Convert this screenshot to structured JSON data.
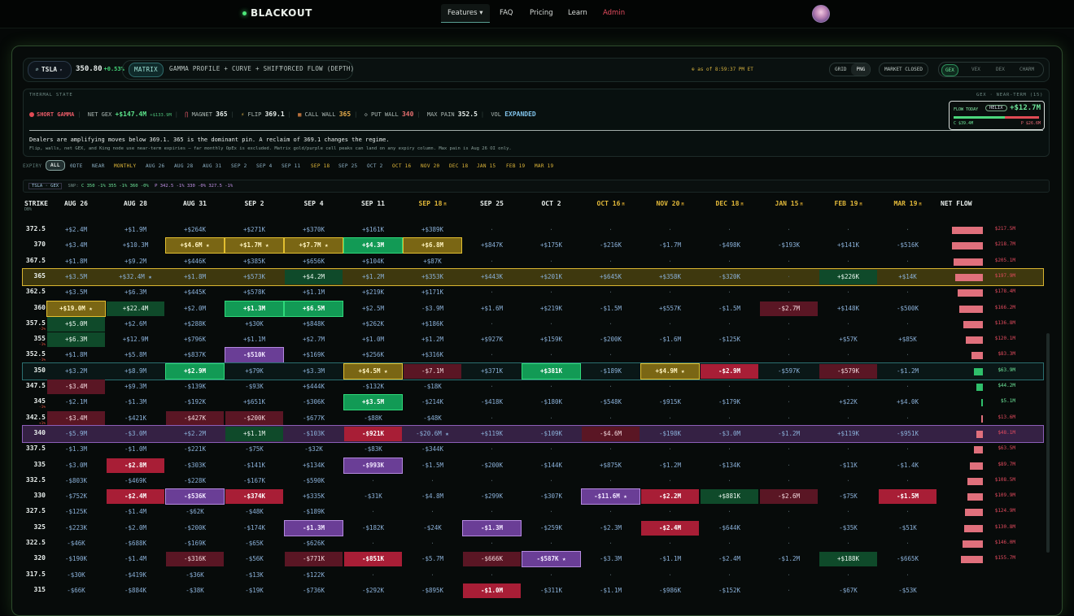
{
  "nav": {
    "brand": "BLACKOUT",
    "items": [
      {
        "label": "Features ▾",
        "active": true
      },
      {
        "label": "FAQ"
      },
      {
        "label": "Pricing"
      },
      {
        "label": "Learn"
      },
      {
        "label": "Admin",
        "admin": true
      }
    ]
  },
  "toolbar": {
    "ticker": "TSLA",
    "price": "350.80",
    "change": "+0.53%",
    "views": [
      "MATRIX",
      "GAMMA PROFILE + CURVE + SHIFT",
      "FORCED FLOW (DEPTH)"
    ],
    "as_of": "⊕ as of 8:59:37 PM ET",
    "layout_toggle": [
      "GRID",
      "PNG"
    ],
    "market_status": "MARKET CLOSED",
    "greeks": [
      "GEX",
      "VEX",
      "DEX",
      "CHARM"
    ]
  },
  "thermal": {
    "title": "THERMAL STATE",
    "right_label": "GEX · NEAR-TERM (15)",
    "gamma": "SHORT GAMMA",
    "net_gex_label": "NET GEX",
    "net_gex": "+$147.4M",
    "net_gex_sub": "+$133.9M",
    "magnet_label": "MAGNET",
    "magnet": "365",
    "flip_label": "FLIP",
    "flip": "369.1",
    "call_wall_label": "CALL WALL",
    "call_wall": "365",
    "put_wall_label": "PUT WALL",
    "put_wall": "340",
    "max_pain_label": "MAX PAIN",
    "max_pain": "352.5",
    "vol_label": "VOL",
    "vol": "EXPANDED",
    "flow_today_label": "FLOW TODAY",
    "flow_badge": "HELIX",
    "flow_today": "+$12.7M",
    "flow_call": "C $39.4M",
    "flow_put": "P $26.6M",
    "flow_call_share": 0.6,
    "message": "Dealers are amplifying moves below 369.1. 365 is the dominant pin. A reclaim of 369.1 changes the regime.",
    "note": "Flip, walls, net GEX, and King node use near-term expiries — far monthly OpEx is excluded. Matrix gold/purple cell peaks can land on any expiry column. Max pain is Aug 26 OI only."
  },
  "expiry": {
    "label": "EXPIRY",
    "items": [
      {
        "label": "ALL",
        "on": true
      },
      {
        "label": "0DTE"
      },
      {
        "label": "NEAR"
      },
      {
        "label": "MONTHLY",
        "m": true
      },
      {
        "label": "AUG 26"
      },
      {
        "label": "AUG 28"
      },
      {
        "label": "AUG 31"
      },
      {
        "label": "SEP 2"
      },
      {
        "label": "SEP 4"
      },
      {
        "label": "SEP 11"
      },
      {
        "label": "SEP 18",
        "m": true
      },
      {
        "label": "SEP 25"
      },
      {
        "label": "OCT 2"
      },
      {
        "label": "OCT 16",
        "m": true
      },
      {
        "label": "NOV 20",
        "m": true
      },
      {
        "label": "DEC 18",
        "m": true
      },
      {
        "label": "JAN 15",
        "m": true
      },
      {
        "label": "FEB 19",
        "m": true
      },
      {
        "label": "MAR 19",
        "m": true
      }
    ]
  },
  "snapshot": {
    "tag": "TSLA · GEX",
    "label": "SNP:",
    "calls": "C 350 -1% 355 -1% 360 -0%",
    "puts": "P 342.5 -1% 330 -0% 327.5 -1%"
  },
  "matrix": {
    "strike_header": "STRIKE",
    "strike_sub": "DB%",
    "net_flow_header": "NET FLOW",
    "columns": [
      {
        "label": "AUG 26"
      },
      {
        "label": "AUG 28"
      },
      {
        "label": "AUG 31"
      },
      {
        "label": "SEP 2"
      },
      {
        "label": "SEP 4"
      },
      {
        "label": "SEP 11"
      },
      {
        "label": "SEP 18",
        "m": true
      },
      {
        "label": "SEP 25"
      },
      {
        "label": "OCT 2"
      },
      {
        "label": "OCT 16",
        "m": true
      },
      {
        "label": "NOV 20",
        "m": true
      },
      {
        "label": "DEC 18",
        "m": true
      },
      {
        "label": "JAN 15",
        "m": true
      },
      {
        "label": "FEB 19",
        "m": true
      },
      {
        "label": "MAR 19",
        "m": true
      }
    ],
    "rows": [
      {
        "strike": "372.5",
        "cells": [
          "+$2.4M",
          "+$1.9M",
          "+$264K",
          "+$271K",
          "+$370K",
          "+$161K",
          "+$389K",
          "·",
          "·",
          "·",
          "·",
          "·",
          "·",
          "·",
          "·"
        ],
        "flow": "$217.5M",
        "flowv": 217.5
      },
      {
        "strike": "370",
        "cells": [
          "+$3.4M",
          "+$10.3M",
          "+$4.6M ★|y2",
          "+$1.7M ★|y2",
          "+$7.7M ★|y2",
          "+$4.3M|g2",
          "+$6.8M|y2",
          "+$847K",
          "+$175K",
          "-$216K",
          "-$1.7M",
          "-$498K",
          "-$193K",
          "+$141K",
          "-$516K"
        ],
        "flow": "$218.7M",
        "flowv": 218.7
      },
      {
        "strike": "367.5",
        "cells": [
          "+$1.8M",
          "+$9.2M",
          "+$446K",
          "+$385K",
          "+$656K",
          "+$104K",
          "+$87K",
          "·",
          "·",
          "·",
          "·",
          "·",
          "·",
          "·",
          "·"
        ],
        "flow": "$205.1M",
        "flowv": 205.1
      },
      {
        "strike": "365",
        "row": "gold",
        "cells": [
          "+$3.5M",
          "+$32.4M ★",
          "+$1.8M",
          "+$573K",
          "+$4.2M|g1",
          "+$1.2M",
          "+$353K",
          "+$443K",
          "+$201K",
          "+$645K",
          "+$358K",
          "-$320K",
          "·",
          "+$226K|g1",
          "+$14K"
        ],
        "flow": "$197.9M",
        "flowv": 197.9
      },
      {
        "strike": "362.5",
        "cells": [
          "+$3.5M",
          "+$6.3M",
          "+$445K",
          "+$578K",
          "+$1.1M",
          "+$219K",
          "+$171K",
          "·",
          "·",
          "·",
          "·",
          "·",
          "·",
          "·",
          "·"
        ],
        "flow": "$178.4M",
        "flowv": 178.4
      },
      {
        "strike": "360",
        "cells": [
          "+$19.0M ★|y2",
          "+$22.4M|g1",
          "+$2.0M",
          "+$1.3M|g2",
          "+$6.5M|g2",
          "+$2.5M",
          "-$3.9M",
          "+$1.6M",
          "+$219K",
          "-$1.5M",
          "+$557K",
          "-$1.5M",
          "-$2.7M|r1",
          "+$148K",
          "-$500K"
        ],
        "flow": "$166.2M",
        "flowv": 166.2
      },
      {
        "strike": "357.5",
        "sub": "-2%",
        "cells": [
          "+$5.0M|g1",
          "+$2.6M",
          "+$288K",
          "+$30K",
          "+$848K",
          "+$262K",
          "+$186K",
          "·",
          "·",
          "·",
          "·",
          "·",
          "·",
          "·",
          "·"
        ],
        "flow": "$136.8M",
        "flowv": 136.8
      },
      {
        "strike": "355",
        "sub": "-1%",
        "cells": [
          "+$6.3M|g1",
          "+$12.9M",
          "+$796K",
          "+$1.1M",
          "+$2.7M",
          "+$1.0M",
          "+$1.2M",
          "+$927K",
          "+$159K",
          "-$200K",
          "-$1.6M",
          "-$125K",
          "·",
          "+$57K",
          "+$85K"
        ],
        "flow": "$120.1M",
        "flowv": 120.1
      },
      {
        "strike": "352.5",
        "sub": "-1%",
        "cells": [
          "+$1.8M",
          "+$5.8M",
          "+$837K",
          "-$510K|p1",
          "+$169K",
          "+$256K",
          "+$316K",
          "·",
          "·",
          "·",
          "·",
          "·",
          "·",
          "·",
          "·"
        ],
        "flow": "$83.3M",
        "flowv": 83.3
      },
      {
        "strike": "350",
        "row": "teal",
        "cells": [
          "+$3.2M",
          "+$8.9M",
          "+$2.9M|g2",
          "+$79K",
          "+$3.3M",
          "+$4.5M ★|y2",
          "-$7.1M|r1",
          "+$371K",
          "+$381K|g2",
          "-$189K",
          "+$4.9M ★|y2",
          "-$2.9M|r2",
          "-$597K",
          "-$579K|r1",
          "-$1.2M"
        ],
        "flow": "$63.9M",
        "flowv": 63.9,
        "flowpos": true
      },
      {
        "strike": "347.5",
        "cells": [
          "-$3.4M|r1",
          "+$9.3M",
          "-$139K",
          "-$93K",
          "+$444K",
          "-$132K",
          "-$18K",
          "·",
          "·",
          "·",
          "·",
          "·",
          "·",
          "·",
          "·"
        ],
        "flow": "$44.2M",
        "flowv": 44.2,
        "flowpos": true
      },
      {
        "strike": "345",
        "sub": "-1%",
        "cells": [
          "-$2.1M",
          "-$1.3M",
          "-$192K",
          "+$651K",
          "-$306K",
          "+$3.5M|g2",
          "-$214K",
          "-$418K",
          "-$180K",
          "-$548K",
          "-$915K",
          "-$179K",
          "·",
          "+$22K",
          "+$4.0K"
        ],
        "flow": "$5.1M",
        "flowv": 5.1,
        "flowpos": true
      },
      {
        "strike": "342.5",
        "sub": "+1%",
        "cells": [
          "-$3.4M|r1",
          "-$421K",
          "-$427K|r1",
          "-$200K|r1",
          "-$677K",
          "-$88K",
          "-$48K",
          "·",
          "·",
          "·",
          "·",
          "·",
          "·",
          "·",
          "·"
        ],
        "flow": "$13.6M",
        "flowv": 13.6
      },
      {
        "strike": "340",
        "row": "purple",
        "cells": [
          "-$5.9M",
          "-$3.0M",
          "+$2.2M",
          "+$1.1M|g1",
          "-$103K",
          "-$921K|r2",
          "-$20.6M ★",
          "+$119K",
          "-$109K",
          "-$4.6M|r1",
          "-$198K",
          "-$3.0M",
          "-$1.2M",
          "+$119K",
          "-$951K"
        ],
        "flow": "$48.1M",
        "flowv": 48.1
      },
      {
        "strike": "337.5",
        "cells": [
          "-$1.3M",
          "-$1.0M",
          "-$221K",
          "-$75K",
          "-$32K",
          "-$83K",
          "-$344K",
          "·",
          "·",
          "·",
          "·",
          "·",
          "·",
          "·",
          "·"
        ],
        "flow": "$63.5M",
        "flowv": 63.5
      },
      {
        "strike": "335",
        "cells": [
          "-$3.0M",
          "-$2.8M|r2",
          "-$303K",
          "-$141K",
          "+$134K",
          "-$993K|p1",
          "-$1.5M",
          "-$200K",
          "-$144K",
          "+$875K",
          "-$1.2M",
          "-$134K",
          "·",
          "-$11K",
          "-$1.4K"
        ],
        "flow": "$89.7M",
        "flowv": 89.7
      },
      {
        "strike": "332.5",
        "cells": [
          "-$803K",
          "-$469K",
          "-$228K",
          "-$167K",
          "-$590K",
          "·",
          "·",
          "·",
          "·",
          "·",
          "·",
          "·",
          "·",
          "·",
          "·"
        ],
        "flow": "$108.5M",
        "flowv": 108.5
      },
      {
        "strike": "330",
        "cells": [
          "-$752K",
          "-$2.4M|r2",
          "-$536K|p1",
          "-$374K|r2",
          "+$335K",
          "-$31K",
          "-$4.8M",
          "-$299K",
          "-$307K",
          "-$11.6M ★|p1",
          "-$2.2M|r2",
          "+$881K|g1",
          "-$2.6M|r1",
          "-$75K",
          "-$1.5M|r2"
        ],
        "flow": "$109.9M",
        "flowv": 109.9
      },
      {
        "strike": "327.5",
        "cells": [
          "-$125K",
          "-$1.4M",
          "-$62K",
          "-$48K",
          "-$189K",
          "·",
          "·",
          "·",
          "·",
          "·",
          "·",
          "·",
          "·",
          "·",
          "·"
        ],
        "flow": "$124.9M",
        "flowv": 124.9
      },
      {
        "strike": "325",
        "cells": [
          "-$223K",
          "-$2.0M",
          "-$200K",
          "-$174K",
          "-$1.3M|p1",
          "-$182K",
          "-$24K",
          "-$1.3M|p1",
          "-$259K",
          "-$2.3M",
          "-$2.4M|r2",
          "-$644K",
          "·",
          "-$35K",
          "-$51K"
        ],
        "flow": "$130.8M",
        "flowv": 130.8
      },
      {
        "strike": "322.5",
        "cells": [
          "-$46K",
          "-$688K",
          "-$169K",
          "-$65K",
          "-$626K",
          "·",
          "·",
          "·",
          "·",
          "·",
          "·",
          "·",
          "·",
          "·",
          "·"
        ],
        "flow": "$146.0M",
        "flowv": 146.0
      },
      {
        "strike": "320",
        "cells": [
          "-$190K",
          "-$1.4M",
          "-$316K|r1",
          "-$56K",
          "-$771K|r1",
          "-$851K|r2",
          "-$5.7M",
          "-$666K|r1",
          "-$587K ★|p1",
          "-$3.3M",
          "-$1.1M",
          "-$2.4M",
          "-$1.2M",
          "+$188K|g1",
          "-$665K"
        ],
        "flow": "$155.7M",
        "flowv": 155.7
      },
      {
        "strike": "317.5",
        "cells": [
          "-$30K",
          "-$419K",
          "-$36K",
          "-$13K",
          "-$122K",
          "·",
          "·",
          "·",
          "·",
          "·",
          "·",
          "·",
          "·",
          "·",
          "·"
        ],
        "flow": "",
        "flowv": 0
      },
      {
        "strike": "315",
        "cells": [
          "-$66K",
          "-$884K",
          "-$38K",
          "-$19K",
          "-$736K",
          "-$292K",
          "-$895K",
          "-$1.0M|r2",
          "-$311K",
          "-$1.1M",
          "-$986K",
          "-$152K",
          "·",
          "-$67K",
          "-$53K"
        ],
        "flow": "",
        "flowv": 0
      }
    ]
  }
}
